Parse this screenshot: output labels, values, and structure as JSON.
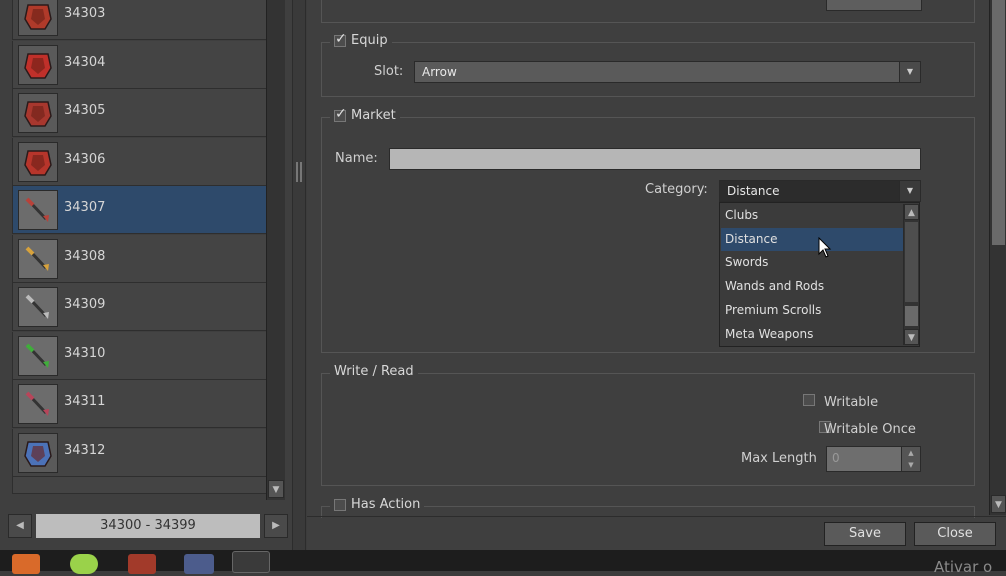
{
  "items": [
    {
      "id": "34303",
      "color": "#b03a2a",
      "kind": "helmet"
    },
    {
      "id": "34304",
      "color": "#c0302a",
      "kind": "armor"
    },
    {
      "id": "34305",
      "color": "#a8372e",
      "kind": "legs"
    },
    {
      "id": "34306",
      "color": "#b7352b",
      "kind": "boots"
    },
    {
      "id": "34307",
      "color": "#b8423a",
      "kind": "arrow",
      "selected": true
    },
    {
      "id": "34308",
      "color": "#d7a23c",
      "kind": "arrow"
    },
    {
      "id": "34309",
      "color": "#bcbcbc",
      "kind": "arrow"
    },
    {
      "id": "34310",
      "color": "#3fae3a",
      "kind": "arrow"
    },
    {
      "id": "34311",
      "color": "#b8455a",
      "kind": "arrow"
    },
    {
      "id": "34312",
      "color": "#4c72b8",
      "kind": "helmet-blue"
    }
  ],
  "pager": {
    "range": "34300 - 34399"
  },
  "equip": {
    "label": "Equip",
    "checked": true,
    "slot_label": "Slot:",
    "slot_value": "Arrow"
  },
  "market": {
    "label": "Market",
    "checked": true,
    "name_label": "Name:",
    "name_value": "",
    "category_label": "Category:",
    "category_value": "Distance"
  },
  "category_options": [
    "Clubs",
    "Distance",
    "Swords",
    "Wands and Rods",
    "Premium Scrolls",
    "Meta Weapons"
  ],
  "write_read": {
    "label": "Write / Read",
    "writable": "Writable",
    "writable_once": "Writable Once",
    "max_length_label": "Max Length",
    "max_length_value": "0"
  },
  "has_action": {
    "label": "Has Action",
    "checked": false
  },
  "buttons": {
    "save": "Save",
    "close": "Close"
  },
  "watermark": "Ativar o"
}
